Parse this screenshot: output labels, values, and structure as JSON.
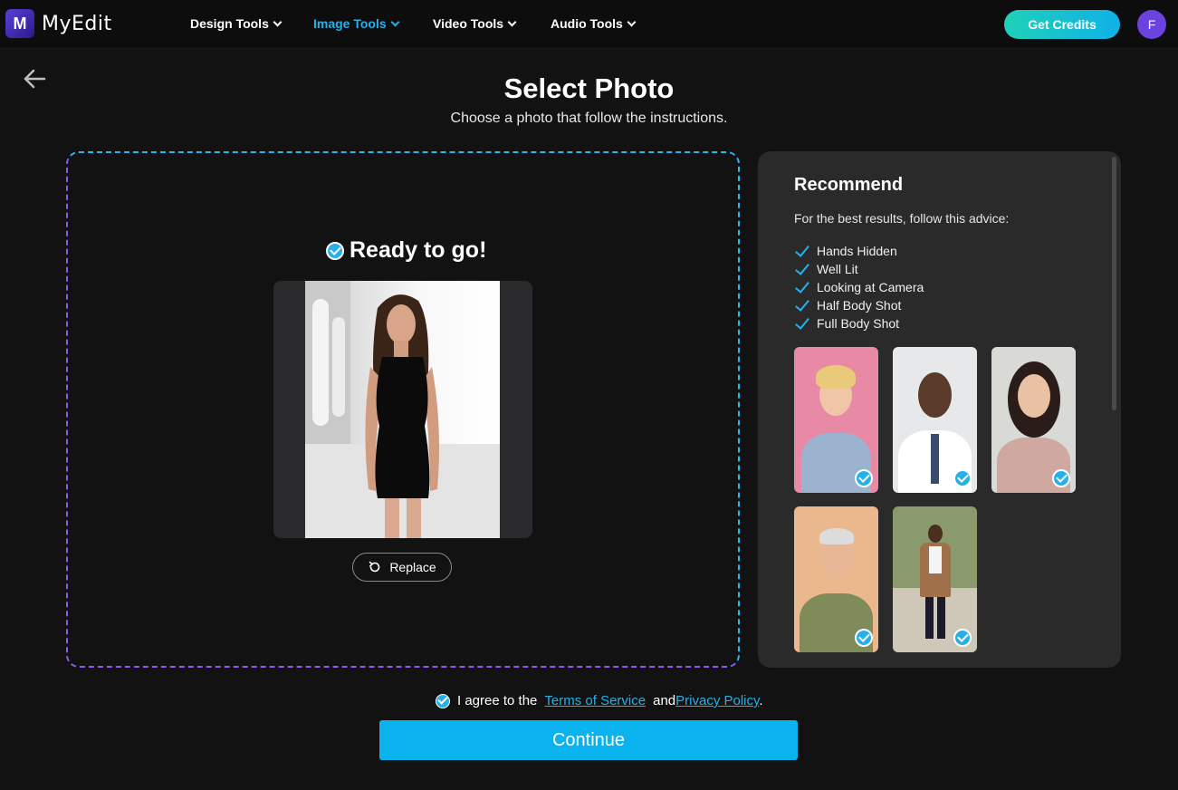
{
  "header": {
    "logo_mark": "M",
    "logo_text": "MyEdit",
    "nav": [
      {
        "label": "Design Tools"
      },
      {
        "label": "Image Tools"
      },
      {
        "label": "Video Tools"
      },
      {
        "label": "Audio Tools"
      }
    ],
    "active_nav": "Image Tools",
    "credits_label": "Get Credits",
    "avatar_initial": "F"
  },
  "page": {
    "title": "Select Photo",
    "subtitle": "Choose a photo that follow the instructions."
  },
  "upload": {
    "status": "Ready to go!",
    "replace_label": "Replace"
  },
  "recommend": {
    "title": "Recommend",
    "advice": "For the best results, follow this advice:",
    "items": [
      "Hands Hidden",
      "Well Lit",
      "Looking at Camera",
      "Half Body Shot",
      "Full Body Shot"
    ]
  },
  "footer": {
    "agree_prefix": "I agree to the",
    "terms_label": "Terms of Service",
    "and_label": "and",
    "privacy_label": "Privacy Policy",
    "period": ".",
    "continue_label": "Continue"
  },
  "colors": {
    "accent": "#27b0e8",
    "background": "#121212",
    "panel": "#2a2a2b",
    "continue": "#0ab3ee",
    "avatar": "#6a42e0"
  }
}
